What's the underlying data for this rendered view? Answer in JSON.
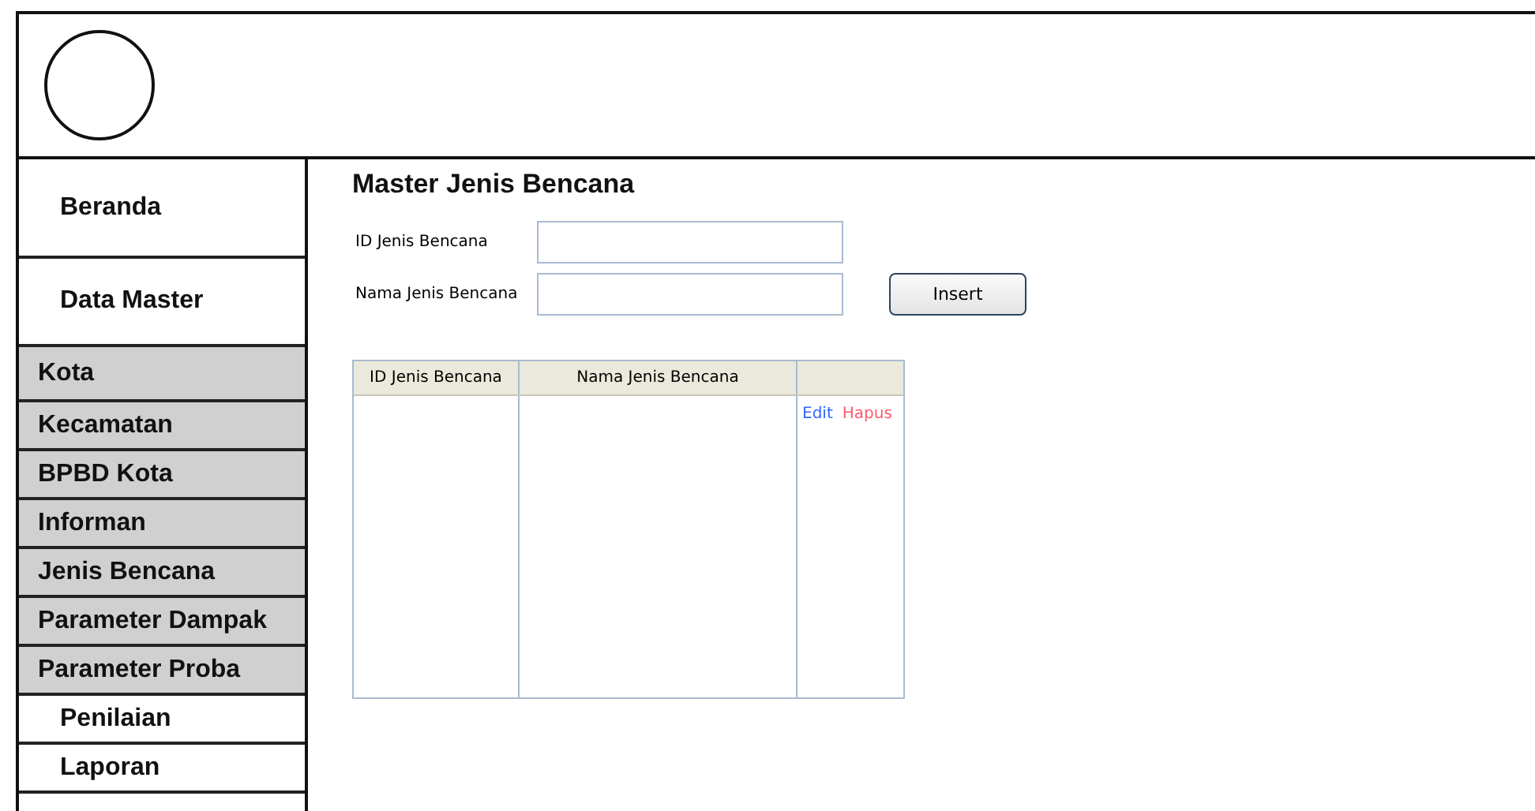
{
  "sidebar": {
    "items": [
      {
        "label": "Beranda",
        "kind": "main"
      },
      {
        "label": "Data Master",
        "kind": "main"
      },
      {
        "label": "Kota",
        "kind": "sub"
      },
      {
        "label": "Kecamatan",
        "kind": "sub"
      },
      {
        "label": "BPBD Kota",
        "kind": "sub"
      },
      {
        "label": "Informan",
        "kind": "sub"
      },
      {
        "label": "Jenis Bencana",
        "kind": "sub"
      },
      {
        "label": "Parameter Dampak",
        "kind": "sub"
      },
      {
        "label": "Parameter Proba",
        "kind": "sub"
      },
      {
        "label": "Penilaian",
        "kind": "main"
      },
      {
        "label": "Laporan",
        "kind": "main"
      }
    ]
  },
  "page_title": "Master Jenis Bencana",
  "form": {
    "fields": [
      {
        "label": "ID Jenis Bencana"
      },
      {
        "label": "Nama Jenis Bencana"
      }
    ],
    "button": "Insert"
  },
  "table": {
    "columns": [
      "ID Jenis Bencana",
      "Nama Jenis Bencana"
    ],
    "actions": [
      {
        "label": "Edit",
        "color": "#3366ff"
      },
      {
        "label": "Hapus",
        "color": "#ff5a6a"
      }
    ]
  }
}
